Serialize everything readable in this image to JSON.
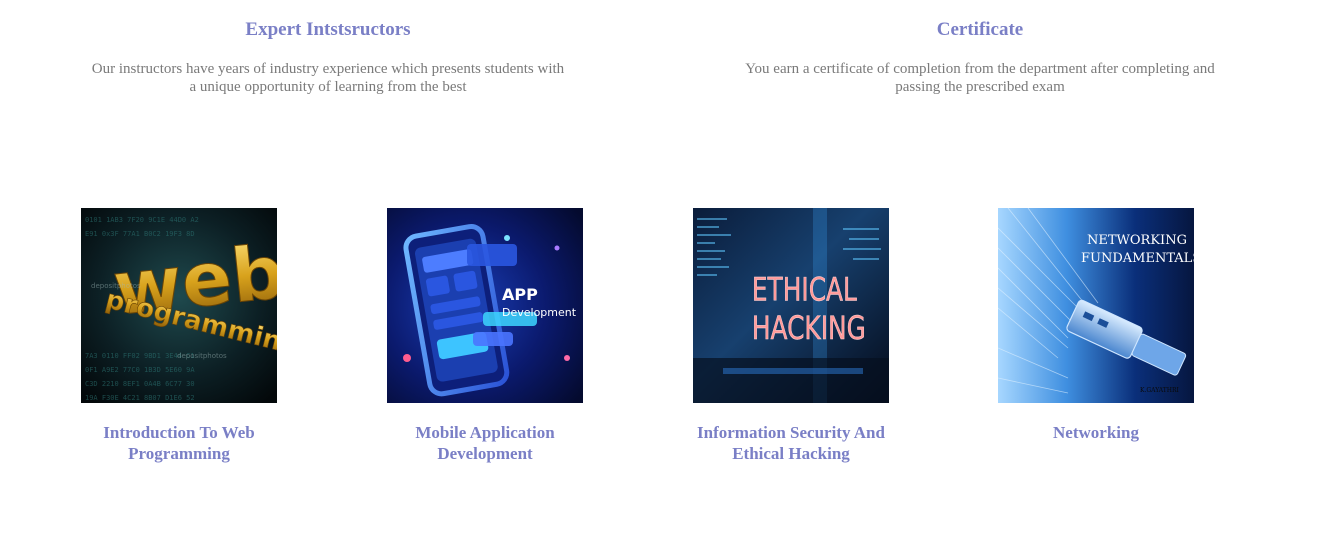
{
  "features": [
    {
      "title": "Expert Intstsructors",
      "text": "Our instructors have years of industry experience which presents students with a unique opportunity of learning from the best"
    },
    {
      "title": "Certificate",
      "text": "You earn a certificate of completion from the department after completing and passing the prescribed exam"
    }
  ],
  "courses": [
    {
      "title": "Introduction To Web Programming",
      "image": {
        "line1": "web",
        "line2": "programming",
        "watermark": "depositphotos"
      }
    },
    {
      "title": "Mobile Application Development",
      "image": {
        "line1": "APP",
        "line2": "Development"
      }
    },
    {
      "title": "Information Security And Ethical Hacking",
      "image": {
        "line1": "ETHICAL",
        "line2": "HACKING"
      }
    },
    {
      "title": "Networking",
      "image": {
        "line1": "NETWORKING",
        "line2": "FUNDAMENTALS",
        "credit": "K.GAYATHRI"
      }
    }
  ],
  "colors": {
    "heading": "#7a7fc6",
    "body_text": "#7a7a7a"
  }
}
